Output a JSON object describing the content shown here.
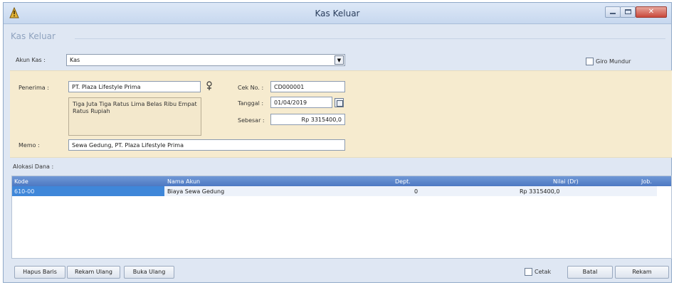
{
  "window": {
    "title": "Kas Keluar",
    "close_glyph": "✕"
  },
  "page_header": "Kas Keluar",
  "akun_kas": {
    "label": "Akun Kas :",
    "value": "Kas"
  },
  "giro_mundur": {
    "label": "Giro Mundur",
    "checked": false
  },
  "penerima": {
    "label": "Penerima :",
    "value": "PT. Plaza Lifestyle Prima"
  },
  "terbilang": "Tiga Juta Tiga Ratus Lima Belas Ribu Empat Ratus Rupiah",
  "cek_no": {
    "label": "Cek No. :",
    "value": "CD000001"
  },
  "tanggal": {
    "label": "Tanggal :",
    "value": "01/04/2019"
  },
  "sebesar": {
    "label": "Sebesar :",
    "value": "Rp 3315400,0"
  },
  "memo": {
    "label": "Memo :",
    "value": "Sewa Gedung, PT. Plaza Lifestyle Prima"
  },
  "alokasi_label": "Alokasi Dana :",
  "grid": {
    "columns": [
      "Kode",
      "Nama Akun",
      "Dept.",
      "Nilai (Dr)",
      "Job."
    ],
    "rows": [
      {
        "kode": "610-00",
        "nama_akun": "Biaya Sewa Gedung",
        "dept": "0",
        "nilai": "Rp 3315400,0",
        "job": ""
      }
    ]
  },
  "buttons": {
    "hapus_baris": "Hapus Baris",
    "rekam_ulang": "Rekam Ulang",
    "buka_ulang": "Buka Ulang",
    "cetak": "Cetak",
    "batal": "Batal",
    "rekam": "Rekam"
  },
  "cetak_checked": false,
  "icons": {
    "app": "warning-triangle-icon",
    "penerima_lookup": "person-lookup-icon",
    "calendar": "calendar-icon",
    "dropdown": "chevron-down-icon"
  }
}
